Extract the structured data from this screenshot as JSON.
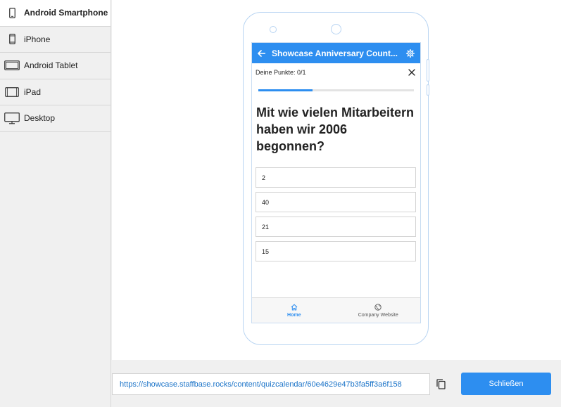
{
  "sidebar": {
    "items": [
      {
        "label": "Android Smartphone",
        "icon": "smartphone-icon",
        "active": true
      },
      {
        "label": "iPhone",
        "icon": "iphone-icon",
        "active": false
      },
      {
        "label": "Android Tablet",
        "icon": "tablet-landscape-icon",
        "active": false
      },
      {
        "label": "iPad",
        "icon": "ipad-icon",
        "active": false
      },
      {
        "label": "Desktop",
        "icon": "desktop-monitor-icon",
        "active": false
      }
    ]
  },
  "app": {
    "title": "Showcase Anniversary Count...",
    "back_icon": "arrow-left-icon",
    "settings_icon": "gear-icon",
    "points_label": "Deine Punkte: 0/1",
    "progress_fraction": 0.35,
    "question": "Mit wie vielen Mitarbeitern haben wir 2006 begonnen?",
    "answers": [
      "2",
      "40",
      "21",
      "15"
    ],
    "nav": [
      {
        "label": "Home",
        "icon": "home-icon",
        "active": true
      },
      {
        "label": "Company Website",
        "icon": "globe-icon",
        "active": false
      }
    ]
  },
  "footer": {
    "url": "https://showcase.staffbase.rocks/content/quizcalendar/60e4629e47b3fa5ff3a6f158",
    "copy_icon": "copy-icon",
    "close_label": "Schließen"
  },
  "colors": {
    "accent": "#2d8ef0",
    "link": "#1a73c8"
  }
}
